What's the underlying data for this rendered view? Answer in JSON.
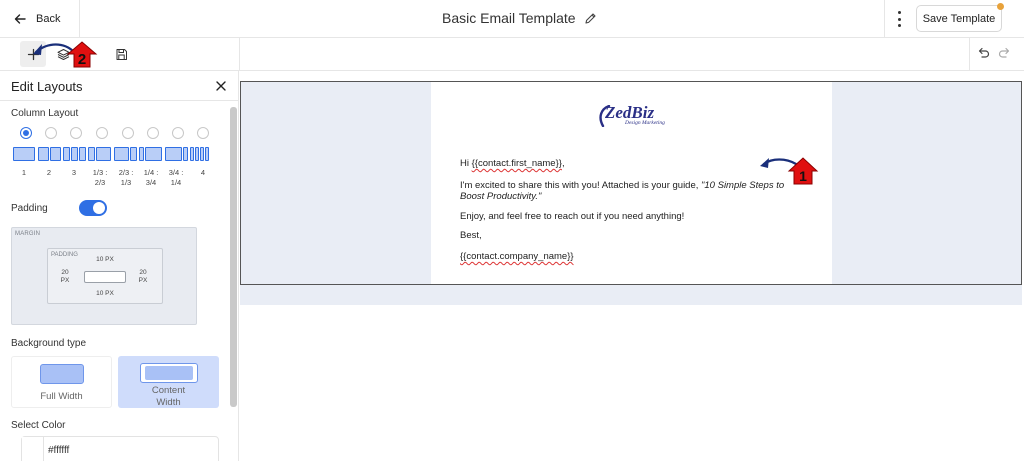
{
  "header": {
    "back_label": "Back",
    "title": "Basic Email Template",
    "save_label": "Save Template"
  },
  "panel": {
    "title": "Edit Layouts",
    "column_layout_label": "Column Layout",
    "selected_layout_index": 0,
    "layout_labels": [
      "1",
      "2",
      "3",
      "1/3 :\n2/3",
      "2/3 :\n1/3",
      "1/4 :\n3/4",
      "3/4 :\n1/4",
      "4"
    ],
    "padding_label": "Padding",
    "padding_enabled": true,
    "margin_label": "MARGIN",
    "padding_box_label": "PADDING",
    "padding_top": "10 PX",
    "padding_bottom": "10 PX",
    "padding_left_value": "20",
    "padding_left_unit": "PX",
    "padding_right_value": "20",
    "padding_right_unit": "PX",
    "background_type_label": "Background type",
    "bg_full_label": "Full Width",
    "bg_content_label_1": "Content",
    "bg_content_label_2": "Width",
    "select_color_label": "Select Color",
    "color_value": "#ffffff"
  },
  "email": {
    "logo_main": "ZedBiz",
    "logo_sub": "Design Marketing",
    "greeting_prefix": "Hi ",
    "greeting_token": "{{contact.first_name}}",
    "greeting_suffix": ",",
    "line1_text": "I'm excited to share this with you! Attached is your guide, ",
    "line1_em_1": "\"10 Simple Steps to",
    "line1_em_2": "Boost Productivity.\"",
    "line2": "Enjoy, and feel free to reach out if you need anything!",
    "signoff": "Best,",
    "company_token": "{{contact.company_name}}"
  },
  "annotations": {
    "marker_1": "1",
    "marker_2": "2"
  },
  "colors": {
    "accent": "#2f6fe4",
    "notification": "#e8a23a",
    "marker_red": "#e01010",
    "logo_navy": "#2a2f86"
  }
}
